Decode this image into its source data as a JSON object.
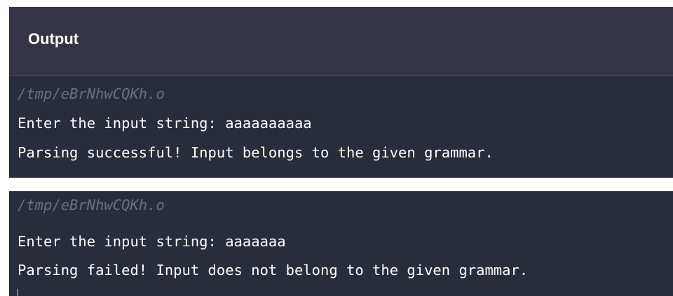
{
  "panel_top": {
    "header": {
      "title": "Output"
    },
    "path": "/tmp/eBrNhwCQKh.o",
    "lines": [
      "Enter the input string: aaaaaaaaaa",
      "Parsing successful! Input belongs to the given grammar."
    ]
  },
  "panel_bottom": {
    "path": "/tmp/eBrNhwCQKh.o",
    "lines": [
      "Enter the input string: aaaaaaa",
      "Parsing failed! Input does not belong to the given grammar."
    ]
  },
  "colors": {
    "console_background": "#292c3b",
    "header_background": "#333544",
    "text": "#ffffff",
    "path_text": "#6b6f7f"
  }
}
